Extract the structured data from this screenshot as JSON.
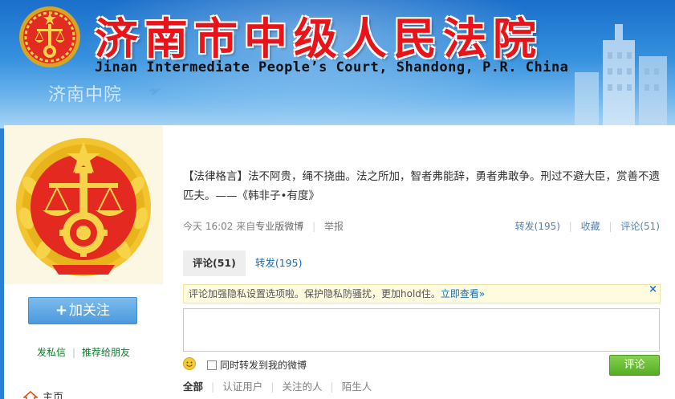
{
  "header": {
    "court_name_cn": "济南市中级人民法院",
    "court_name_en": "Jinan Intermediate People’s Court, Shandong, P.R. China",
    "nickname": "济南中院",
    "verified_icon": "bird-icon"
  },
  "profile": {
    "follow_label": "加关注",
    "follow_icon": "plus",
    "send_message": "发私信",
    "recommend": "推荐给朋友",
    "home_label": "主页",
    "home_icon": "house-icon"
  },
  "post": {
    "text": "【法律格言】法不阿贵，绳不挠曲。法之所加，智者弗能辞，勇者弗敢争。刑过不避大臣，赏善不遗匹夫。——《韩非子•有度》",
    "time": "今天 16:02",
    "source_prefix": "来自",
    "source": "专业版微博",
    "report": "举报",
    "repost": "转发(195)",
    "favorite": "收藏",
    "comment": "评论(51)"
  },
  "tabs": [
    {
      "label": "评论(51)",
      "active": true
    },
    {
      "label": "转发(195)",
      "active": false
    }
  ],
  "notice": {
    "text": "评论加强隐私设置选项啦。保护隐私防骚扰，更加hold住。",
    "link": "立即查看»",
    "close": "×"
  },
  "comment_form": {
    "placeholder": "",
    "repost_checkbox_label": "同时转发到我的微博",
    "repost_checked": false,
    "submit_label": "评论"
  },
  "filters": [
    {
      "label": "全部",
      "active": true
    },
    {
      "label": "认证用户",
      "active": false
    },
    {
      "label": "关注的人",
      "active": false
    },
    {
      "label": "陌生人",
      "active": false
    }
  ],
  "colors": {
    "banner_blue": "#2a7fd0",
    "court_red": "#e8141a",
    "link_blue": "#1a6fb3",
    "green_link": "#0a7d2b",
    "submit_green": "#55ad23"
  }
}
